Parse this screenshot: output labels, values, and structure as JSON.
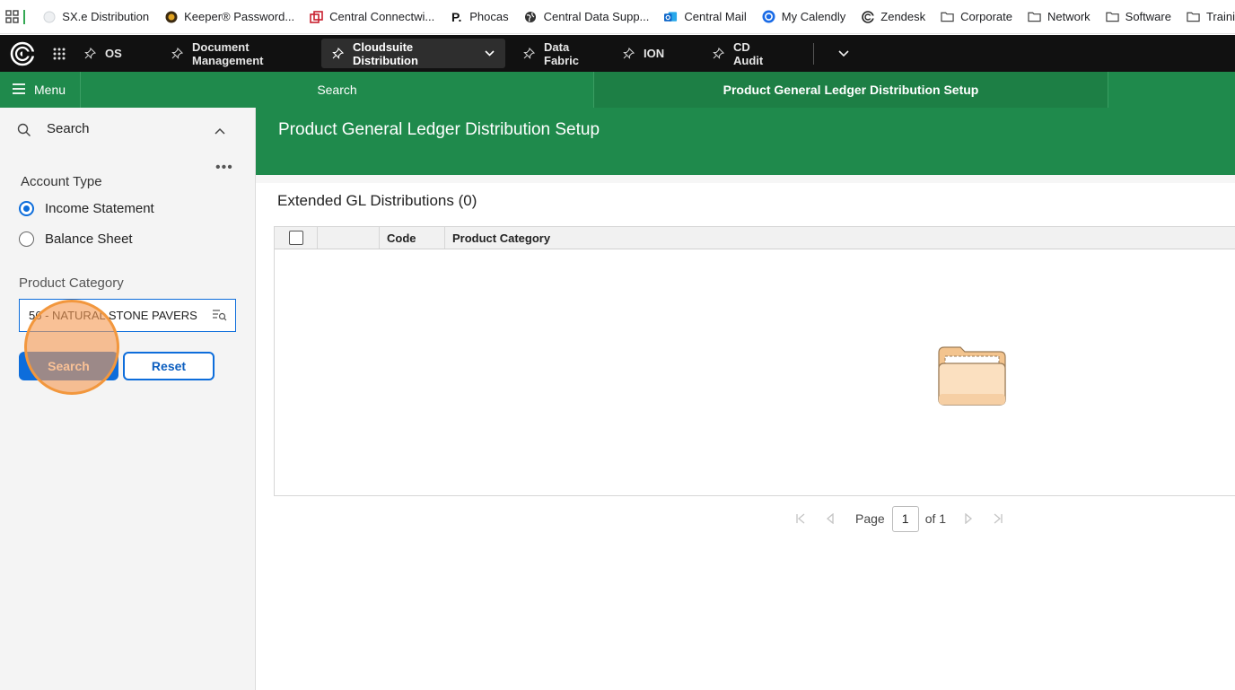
{
  "bookmarks": [
    {
      "label": "SX.e Distribution",
      "icon": "blank-page-icon"
    },
    {
      "label": "Keeper® Password...",
      "icon": "keeper-icon"
    },
    {
      "label": "Central Connectwi...",
      "icon": "connectwise-icon"
    },
    {
      "label": "Phocas",
      "icon": "phocas-icon"
    },
    {
      "label": "Central Data Supp...",
      "icon": "globe-icon"
    },
    {
      "label": "Central Mail",
      "icon": "outlook-icon"
    },
    {
      "label": "My Calendly",
      "icon": "calendly-icon"
    },
    {
      "label": "Zendesk",
      "icon": "cloudsuite-icon"
    },
    {
      "label": "Corporate",
      "icon": "folder-icon"
    },
    {
      "label": "Network",
      "icon": "folder-icon"
    },
    {
      "label": "Software",
      "icon": "folder-icon"
    },
    {
      "label": "Traini",
      "icon": "folder-icon"
    }
  ],
  "topnav": {
    "tabs": [
      {
        "label": "OS"
      },
      {
        "label": "Document Management"
      },
      {
        "label": "Cloudsuite Distribution",
        "active": true
      },
      {
        "label": "Data Fabric"
      },
      {
        "label": "ION"
      },
      {
        "label": "CD Audit"
      }
    ]
  },
  "greenbar": {
    "menu_label": "Menu",
    "search_tab": "Search",
    "active_tab": "Product General Ledger Distribution Setup"
  },
  "left_panel": {
    "header": "Search",
    "account_type_label": "Account Type",
    "radio_income": "Income Statement",
    "radio_balance": "Balance Sheet",
    "selected_account_type": "Income Statement",
    "product_category_label": "Product Category",
    "product_category_value": "56 - NATURAL STONE PAVERS",
    "search_button": "Search",
    "reset_button": "Reset"
  },
  "main": {
    "title": "Product General Ledger Distribution Setup",
    "grid_title": "Extended GL Distributions (0)",
    "columns": [
      "Code",
      "Product Category"
    ],
    "rows": [],
    "pager": {
      "page_label": "Page",
      "current_page": "1",
      "of_label": "of 1"
    }
  },
  "colors": {
    "brand_green": "#1f8a4c",
    "primary_blue": "#0d6ddb",
    "nav_dark": "#111111",
    "click_marker": "#f2973d"
  }
}
